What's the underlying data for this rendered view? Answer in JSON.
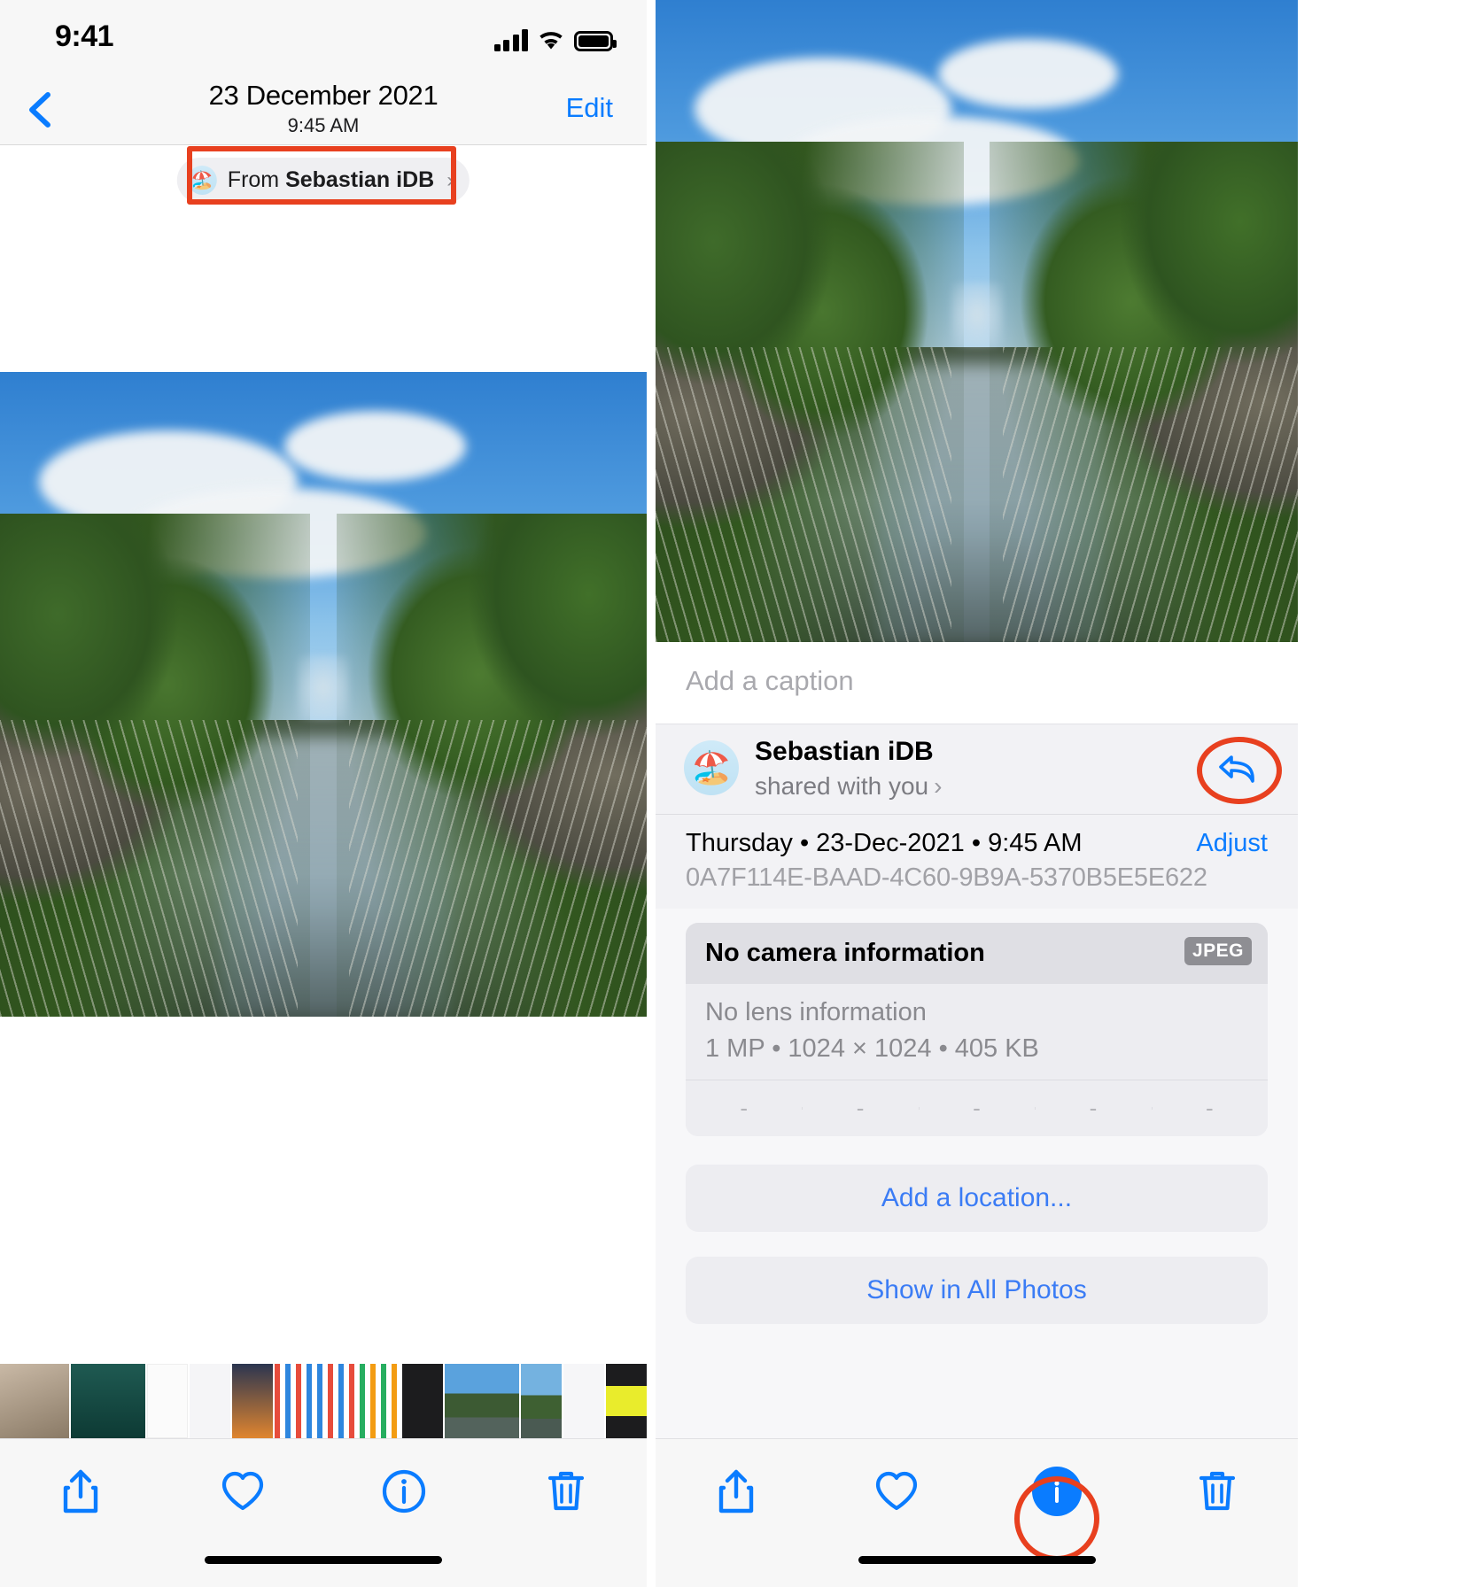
{
  "status_bar": {
    "time": "9:41",
    "cellular_icon": "signal-bars-icon",
    "wifi_icon": "wifi-icon",
    "battery_icon": "battery-full-icon"
  },
  "left_panel": {
    "nav": {
      "back_icon": "chevron-left-icon",
      "title": "23 December 2021",
      "subtitle": "9:45 AM",
      "edit_label": "Edit"
    },
    "from_chip": {
      "avatar_icon": "beach-umbrella-avatar-icon",
      "prefix": "From ",
      "sender": "Sebastian iDB",
      "chevron": "›"
    },
    "annotation": "red-highlight-rectangle",
    "toolbar": {
      "share_icon": "share-icon",
      "favorite_icon": "heart-icon",
      "info_icon": "info-circle-icon",
      "delete_icon": "trash-icon"
    }
  },
  "right_panel": {
    "caption": {
      "placeholder": "Add a caption",
      "value": ""
    },
    "shared_with": {
      "avatar_icon": "beach-umbrella-avatar-icon",
      "name": "Sebastian iDB",
      "subtitle": "shared with you",
      "chevron": "›",
      "reply_icon": "reply-arrow-icon",
      "annotation": "red-highlight-circle"
    },
    "metadata": {
      "date_line": "Thursday • 23-Dec-2021 • 9:45 AM",
      "uuid": "0A7F114E-BAAD-4C60-9B9A-5370B5E5E622",
      "adjust_label": "Adjust"
    },
    "camera_card": {
      "title": "No camera information",
      "format_badge": "JPEG",
      "lens": "No lens information",
      "file_details": "1 MP  •  1024 × 1024  •  405 KB",
      "exif_cells": [
        "-",
        "-",
        "-",
        "-",
        "-"
      ]
    },
    "actions": {
      "add_location": "Add a location...",
      "show_in_all_photos": "Show in All Photos"
    },
    "toolbar": {
      "share_icon": "share-icon",
      "favorite_icon": "heart-icon",
      "info_icon": "info-circle-icon",
      "delete_icon": "trash-icon",
      "active_item": "info-circle-icon",
      "annotation": "red-highlight-circle"
    }
  },
  "colors": {
    "accent_blue": "#0a7cff",
    "link_blue": "#3b7cf5",
    "annotation_red": "#e8401f",
    "muted_gray": "#8a8a8f",
    "panel_bg": "#f2f2f5"
  }
}
